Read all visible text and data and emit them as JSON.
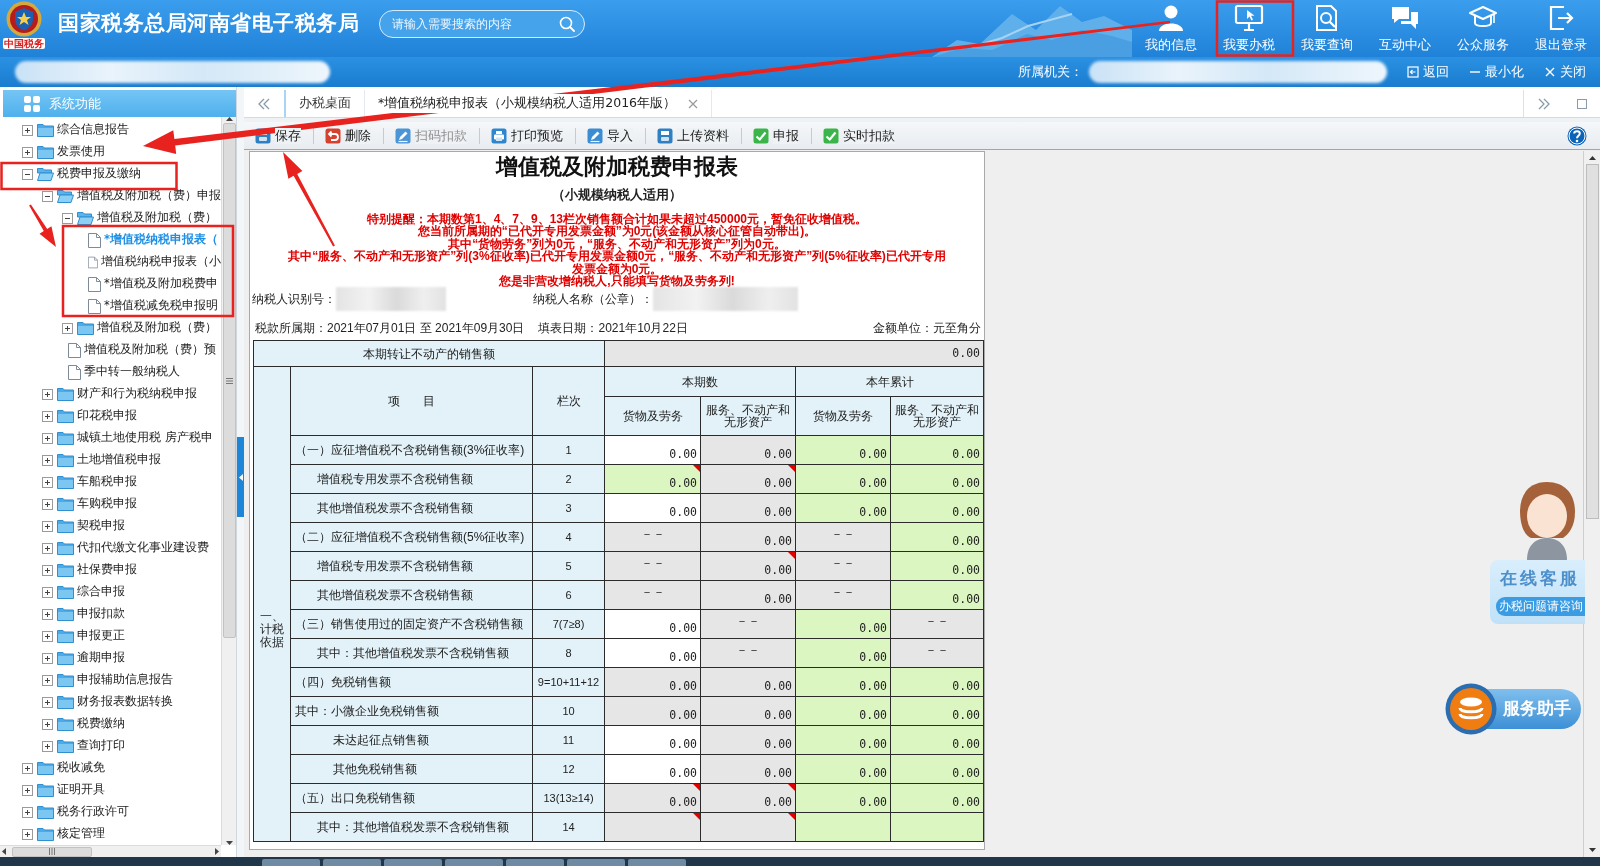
{
  "header": {
    "logo_caption": "中国税务",
    "title": "国家税务总局河南省电子税务局",
    "search": {
      "placeholder": "请输入需要搜索的内容"
    },
    "nav": [
      {
        "label": "我的信息"
      },
      {
        "label": "我要办税"
      },
      {
        "label": "我要查询"
      },
      {
        "label": "互动中心"
      },
      {
        "label": "公众服务"
      },
      {
        "label": "退出登录"
      }
    ]
  },
  "subbar": {
    "org_label": "所属机关：",
    "actions": [
      {
        "label": "返回"
      },
      {
        "label": "最小化"
      },
      {
        "label": "关闭"
      }
    ]
  },
  "sidebar": {
    "title": "系统功能",
    "tree": [
      {
        "label": "综合信息报告",
        "kind": "folder",
        "expanded": false,
        "selected": false
      },
      {
        "label": "发票使用",
        "kind": "folder",
        "expanded": false,
        "selected": false
      },
      {
        "label": "税费申报及缴纳",
        "kind": "folder",
        "expanded": true,
        "selected": false,
        "children": [
          {
            "label": "增值税及附加税（费）申报",
            "kind": "folder",
            "expanded": true,
            "selected": false,
            "children": [
              {
                "label": "增值税及附加税（费）",
                "kind": "folder",
                "expanded": true,
                "selected": false,
                "children": [
                  {
                    "label": "*增值税纳税申报表（",
                    "kind": "doc",
                    "selected": true
                  },
                  {
                    "label": "增值税纳税申报表（小",
                    "kind": "doc",
                    "selected": false
                  },
                  {
                    "label": "*增值税及附加税费申",
                    "kind": "doc",
                    "selected": false
                  },
                  {
                    "label": "*增值税减免税申报明",
                    "kind": "doc",
                    "selected": false
                  }
                ]
              },
              {
                "label": "增值税及附加税（费）",
                "kind": "folder",
                "expanded": false,
                "selected": false
              },
              {
                "label": "增值税及附加税（费）预",
                "kind": "doc",
                "selected": false
              },
              {
                "label": "季中转一般纳税人",
                "kind": "doc",
                "selected": false
              }
            ]
          },
          {
            "label": "财产和行为税纳税申报",
            "kind": "folder",
            "expanded": false,
            "selected": false
          },
          {
            "label": "印花税申报",
            "kind": "folder",
            "expanded": false,
            "selected": false
          },
          {
            "label": "城镇土地使用税 房产税申",
            "kind": "folder",
            "expanded": false,
            "selected": false
          },
          {
            "label": "土地增值税申报",
            "kind": "folder",
            "expanded": false,
            "selected": false
          },
          {
            "label": "车船税申报",
            "kind": "folder",
            "expanded": false,
            "selected": false
          },
          {
            "label": "车购税申报",
            "kind": "folder",
            "expanded": false,
            "selected": false
          },
          {
            "label": "契税申报",
            "kind": "folder",
            "expanded": false,
            "selected": false
          },
          {
            "label": "代扣代缴文化事业建设费",
            "kind": "folder",
            "expanded": false,
            "selected": false
          },
          {
            "label": "社保费申报",
            "kind": "folder",
            "expanded": false,
            "selected": false
          },
          {
            "label": "综合申报",
            "kind": "folder",
            "expanded": false,
            "selected": false
          },
          {
            "label": "申报扣款",
            "kind": "folder",
            "expanded": false,
            "selected": false
          },
          {
            "label": "申报更正",
            "kind": "folder",
            "expanded": false,
            "selected": false
          },
          {
            "label": "逾期申报",
            "kind": "folder",
            "expanded": false,
            "selected": false
          },
          {
            "label": "申报辅助信息报告",
            "kind": "folder",
            "expanded": false,
            "selected": false
          },
          {
            "label": "财务报表数据转换",
            "kind": "folder",
            "expanded": false,
            "selected": false
          },
          {
            "label": "税费缴纳",
            "kind": "folder",
            "expanded": false,
            "selected": false
          },
          {
            "label": "查询打印",
            "kind": "folder",
            "expanded": false,
            "selected": false
          }
        ]
      },
      {
        "label": "税收减免",
        "kind": "folder",
        "expanded": false,
        "selected": false
      },
      {
        "label": "证明开具",
        "kind": "folder",
        "expanded": false,
        "selected": false
      },
      {
        "label": "税务行政许可",
        "kind": "folder",
        "expanded": false,
        "selected": false
      },
      {
        "label": "核定管理",
        "kind": "folder",
        "expanded": false,
        "selected": false
      }
    ]
  },
  "tabs": [
    {
      "label": "办税桌面",
      "selected": false,
      "closable": false
    },
    {
      "label": "*增值税纳税申报表（小规模纳税人适用2016年版）",
      "selected": true,
      "closable": true
    }
  ],
  "toolbar": [
    {
      "label": "保存",
      "disabled": false
    },
    {
      "label": "删除",
      "disabled": false
    },
    {
      "label": "扫码扣款",
      "disabled": true
    },
    {
      "label": "打印预览",
      "disabled": false
    },
    {
      "label": "导入",
      "disabled": false
    },
    {
      "label": "上传资料",
      "disabled": false
    },
    {
      "label": "申报",
      "disabled": false
    },
    {
      "label": "实时扣款",
      "disabled": false
    }
  ],
  "form": {
    "title": "增值税及附加税费申报表",
    "subtitle": "（小规模纳税人适用）",
    "notices": [
      "特别提醒：本期数第1、4、7、9、13栏次销售额合计如果未超过450000元，暂免征收增值税。",
      "您当前所属期的“已代开专用发票金额”为0元(该金额从核心征管自动带出)。",
      "其中“货物劳务”列为0元，“服务、不动产和无形资产”列为0元。",
      "其中“服务、不动产和无形资产”列(3%征收率)已代开专用发票金额0元，“服务、不动产和无形资产”列(5%征收率)已代开专用发票金额为0元。",
      "您是非营改增纳税人,只能填写货物及劳务列!"
    ],
    "taxpayer_id_label": "纳税人识别号：",
    "taxpayer_name_label": "纳税人名称（公章）：",
    "period": "税款所属期：2021年07月01日 至 2021年09月30日",
    "fill_date": "填表日期：2021年10月22日",
    "unit": "金额单位：元至角分",
    "table": {
      "transfer_row": {
        "label": "本期转让不动产的销售额",
        "value": "0.00"
      },
      "section_label": "一、计税依据",
      "item_header": "项 目",
      "line_header": "栏次",
      "groups": [
        {
          "label": "本期数",
          "columns": [
            "货物及劳务",
            "服务、不动产和无形资产"
          ]
        },
        {
          "label": "本年累计",
          "columns": [
            "货物及劳务",
            "服务、不动产和无形资产"
          ]
        }
      ],
      "rows": [
        {
          "kind": "head",
          "label": "（一）应征增值税不含税销售额(3%征收率)",
          "line": "1",
          "cells": [
            {
              "color": "#ffffff",
              "value": "0.00",
              "flagged": false
            },
            {
              "color": "#e6e6e6",
              "value": "0.00",
              "flagged": false
            },
            {
              "color": "#dcf6c2",
              "value": "0.00",
              "flagged": false
            },
            {
              "color": "#dcf6c2",
              "value": "0.00",
              "flagged": false
            }
          ]
        },
        {
          "kind": "sub",
          "label": "增值税专用发票不含税销售额",
          "line": "2",
          "cells": [
            {
              "color": "#dcf6c2",
              "value": "0.00",
              "flagged": true
            },
            {
              "color": "#e6e6e6",
              "value": "0.00",
              "flagged": true
            },
            {
              "color": "#dcf6c2",
              "value": "0.00",
              "flagged": false
            },
            {
              "color": "#dcf6c2",
              "value": "0.00",
              "flagged": false
            }
          ]
        },
        {
          "kind": "sub",
          "label": "其他增值税发票不含税销售额",
          "line": "3",
          "cells": [
            {
              "color": "#ffffff",
              "value": "0.00",
              "flagged": false
            },
            {
              "color": "#e6e6e6",
              "value": "0.00",
              "flagged": false
            },
            {
              "color": "#dcf6c2",
              "value": "0.00",
              "flagged": false
            },
            {
              "color": "#dcf6c2",
              "value": "0.00",
              "flagged": false
            }
          ]
        },
        {
          "kind": "head",
          "label": "（二）应征增值税不含税销售额(5%征收率)",
          "line": "4",
          "cells": [
            {
              "color": "#e6e6e6",
              "value": "－－",
              "flagged": false
            },
            {
              "color": "#e6e6e6",
              "value": "0.00",
              "flagged": false
            },
            {
              "color": "#e6e6e6",
              "value": "－－",
              "flagged": false
            },
            {
              "color": "#dcf6c2",
              "value": "0.00",
              "flagged": false
            }
          ]
        },
        {
          "kind": "sub",
          "label": "增值税专用发票不含税销售额",
          "line": "5",
          "cells": [
            {
              "color": "#e6e6e6",
              "value": "－－",
              "flagged": false
            },
            {
              "color": "#e6e6e6",
              "value": "0.00",
              "flagged": true
            },
            {
              "color": "#e6e6e6",
              "value": "－－",
              "flagged": false
            },
            {
              "color": "#dcf6c2",
              "value": "0.00",
              "flagged": false
            }
          ]
        },
        {
          "kind": "sub",
          "label": "其他增值税发票不含税销售额",
          "line": "6",
          "cells": [
            {
              "color": "#e6e6e6",
              "value": "－－",
              "flagged": false
            },
            {
              "color": "#e6e6e6",
              "value": "0.00",
              "flagged": false
            },
            {
              "color": "#e6e6e6",
              "value": "－－",
              "flagged": false
            },
            {
              "color": "#dcf6c2",
              "value": "0.00",
              "flagged": false
            }
          ]
        },
        {
          "kind": "head",
          "label": "（三）销售使用过的固定资产不含税销售额",
          "line": "7(7≥8)",
          "cells": [
            {
              "color": "#ffffff",
              "value": "0.00",
              "flagged": false
            },
            {
              "color": "#e6e6e6",
              "value": "－－",
              "flagged": false
            },
            {
              "color": "#dcf6c2",
              "value": "0.00",
              "flagged": false
            },
            {
              "color": "#e6e6e6",
              "value": "－－",
              "flagged": false
            }
          ]
        },
        {
          "kind": "sub",
          "label": "其中：其他增值税发票不含税销售额",
          "line": "8",
          "cells": [
            {
              "color": "#ffffff",
              "value": "0.00",
              "flagged": false
            },
            {
              "color": "#e6e6e6",
              "value": "－－",
              "flagged": false
            },
            {
              "color": "#dcf6c2",
              "value": "0.00",
              "flagged": false
            },
            {
              "color": "#e6e6e6",
              "value": "－－",
              "flagged": false
            }
          ]
        },
        {
          "kind": "head",
          "label": "（四）免税销售额",
          "line": "9=10+11+12",
          "cells": [
            {
              "color": "#e6e6e6",
              "value": "0.00",
              "flagged": false
            },
            {
              "color": "#e6e6e6",
              "value": "0.00",
              "flagged": false
            },
            {
              "color": "#dcf6c2",
              "value": "0.00",
              "flagged": false
            },
            {
              "color": "#dcf6c2",
              "value": "0.00",
              "flagged": false
            }
          ]
        },
        {
          "kind": "head",
          "label": "其中：小微企业免税销售额",
          "line": "10",
          "cells": [
            {
              "color": "#e6e6e6",
              "value": "0.00",
              "flagged": false
            },
            {
              "color": "#e6e6e6",
              "value": "0.00",
              "flagged": false
            },
            {
              "color": "#dcf6c2",
              "value": "0.00",
              "flagged": false
            },
            {
              "color": "#dcf6c2",
              "value": "0.00",
              "flagged": false
            }
          ]
        },
        {
          "kind": "subsub",
          "label": "未达起征点销售额",
          "line": "11",
          "cells": [
            {
              "color": "#ffffff",
              "value": "0.00",
              "flagged": false
            },
            {
              "color": "#e6e6e6",
              "value": "0.00",
              "flagged": false
            },
            {
              "color": "#dcf6c2",
              "value": "0.00",
              "flagged": false
            },
            {
              "color": "#dcf6c2",
              "value": "0.00",
              "flagged": false
            }
          ]
        },
        {
          "kind": "subsub",
          "label": "其他免税销售额",
          "line": "12",
          "cells": [
            {
              "color": "#ffffff",
              "value": "0.00",
              "flagged": false
            },
            {
              "color": "#e6e6e6",
              "value": "0.00",
              "flagged": false
            },
            {
              "color": "#dcf6c2",
              "value": "0.00",
              "flagged": false
            },
            {
              "color": "#dcf6c2",
              "value": "0.00",
              "flagged": false
            }
          ]
        },
        {
          "kind": "head",
          "label": "（五）出口免税销售额",
          "line": "13(13≥14)",
          "cells": [
            {
              "color": "#e6e6e6",
              "value": "0.00",
              "flagged": true
            },
            {
              "color": "#e6e6e6",
              "value": "0.00",
              "flagged": true
            },
            {
              "color": "#dcf6c2",
              "value": "0.00",
              "flagged": false
            },
            {
              "color": "#dcf6c2",
              "value": "0.00",
              "flagged": false
            }
          ]
        },
        {
          "kind": "sub",
          "label": "其中：其他增值税发票不含税销售额",
          "line": "14",
          "cells": [
            {
              "color": "#e6e6e6",
              "flagged": true
            },
            {
              "color": "#e6e6e6",
              "flagged": true
            },
            {
              "color": "#dcf6c2",
              "flagged": false
            },
            {
              "color": "#dcf6c2",
              "flagged": false
            }
          ]
        }
      ]
    }
  },
  "service_widget": {
    "title": "在线客服",
    "subtitle": "办税问题请咨询"
  },
  "assistant_button": {
    "label": "服务助手"
  }
}
